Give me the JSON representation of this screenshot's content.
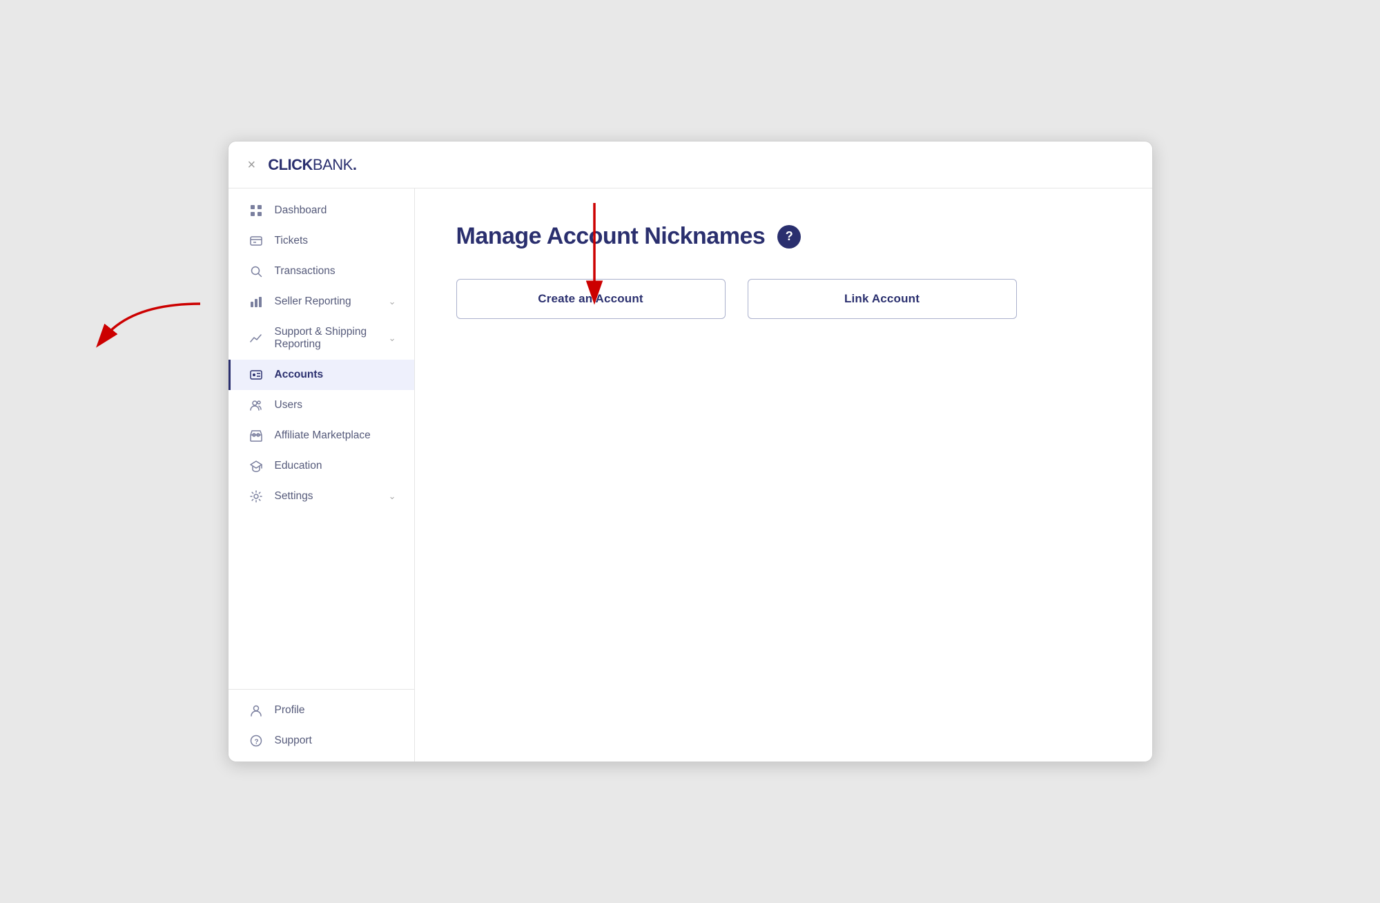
{
  "logo": {
    "click": "CLICK",
    "bank": "BANK",
    "dot": "."
  },
  "close_button": "×",
  "page_title": "Manage Account Nicknames",
  "help_icon": "?",
  "buttons": {
    "create_account": "Create an Account",
    "link_account": "Link Account"
  },
  "sidebar": {
    "items": [
      {
        "id": "dashboard",
        "label": "Dashboard",
        "icon": "grid"
      },
      {
        "id": "tickets",
        "label": "Tickets",
        "icon": "ticket"
      },
      {
        "id": "transactions",
        "label": "Transactions",
        "icon": "search"
      },
      {
        "id": "seller-reporting",
        "label": "Seller Reporting",
        "icon": "bar-chart",
        "has_chevron": true
      },
      {
        "id": "support-shipping",
        "label": "Support & Shipping Reporting",
        "icon": "trend",
        "has_chevron": true
      },
      {
        "id": "accounts",
        "label": "Accounts",
        "icon": "id-card",
        "active": true
      },
      {
        "id": "users",
        "label": "Users",
        "icon": "users"
      },
      {
        "id": "affiliate-marketplace",
        "label": "Affiliate Marketplace",
        "icon": "store"
      },
      {
        "id": "education",
        "label": "Education",
        "icon": "graduation"
      },
      {
        "id": "settings",
        "label": "Settings",
        "icon": "gear",
        "has_chevron": true
      }
    ],
    "bottom_items": [
      {
        "id": "profile",
        "label": "Profile",
        "icon": "person"
      },
      {
        "id": "support",
        "label": "Support",
        "icon": "help-circle"
      }
    ]
  }
}
